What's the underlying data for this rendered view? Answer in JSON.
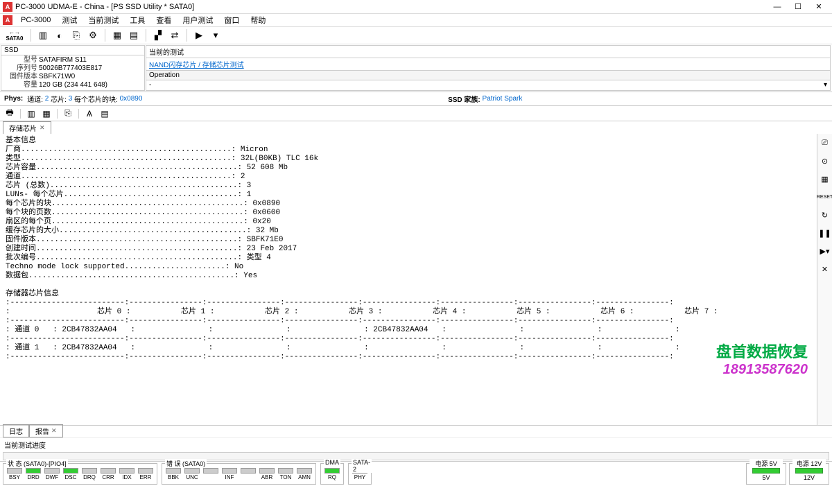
{
  "title": "PC-3000 UDMA-E - China - [PS SSD Utility * SATA0]",
  "menu": {
    "app": "PC-3000",
    "items": [
      "测试",
      "当前测试",
      "工具",
      "查看",
      "用户测试",
      "窗口",
      "帮助"
    ]
  },
  "toolbar_sata": "SATA0",
  "ssd": {
    "header": "SSD",
    "model_k": "型号",
    "model_v": "SATAFIRM   S11",
    "serial_k": "序列号",
    "serial_v": "50026B777403E817",
    "fw_k": "固件版本",
    "fw_v": "SBFK71W0",
    "cap_k": "容量",
    "cap_v": "120 GB (234 441 648)"
  },
  "testpanel": {
    "head": "当前的测试",
    "link": "NAND闪存芯片 / 存储芯片测试",
    "op": "Operation",
    "minus": "-"
  },
  "phys": {
    "label": "Phys:",
    "chan_k": "通道:",
    "chan_v": "2",
    "chip_k": "芯片:",
    "chip_v": "3",
    "blk_k": "每个芯片的块:",
    "blk_v": "0x0890",
    "fam_k": "SSD 家族:",
    "fam_v": "Patriot Spark"
  },
  "tab": "存储芯片",
  "watermark": {
    "l1": "盘首数据恢复",
    "l2": "18913587620"
  },
  "basic_title": "基本信息",
  "basic_rows": [
    [
      "厂商.",
      "Micron"
    ],
    [
      "类型.",
      "32L(B0KB) TLC 16k"
    ],
    [
      "芯片容量.",
      "52 608 Mb"
    ],
    [
      "通道.",
      "2"
    ],
    [
      "芯片 (总数).",
      "3"
    ],
    [
      "LUNs- 每个芯片.",
      "1"
    ],
    [
      "每个芯片的块.",
      "0x0890"
    ],
    [
      "每个块的页数.",
      "0x0600"
    ],
    [
      "扇区的每个页.",
      "0x20"
    ],
    [
      "缓存芯片的大小.",
      "32 Mb"
    ],
    [
      "固件版本.",
      "SBFK71E0"
    ],
    [
      "创建时间.",
      "23 Feb 2017"
    ],
    [
      "批次编号.",
      "类型 4"
    ],
    [
      "Techno mode lock supported.",
      "No"
    ],
    [
      "数据包.",
      "Yes"
    ]
  ],
  "storage_title": "存储器芯片信息",
  "chip_cols": [
    "芯片 0",
    "芯片 1",
    "芯片 2",
    "芯片 3",
    "芯片 4",
    "芯片 5",
    "芯片 6",
    "芯片 7"
  ],
  "chip_rows": [
    {
      "ch": "通道 0",
      "vals": [
        "2CB47832AA04",
        "",
        "",
        "",
        "2CB47832AA04",
        "",
        "",
        ""
      ]
    },
    {
      "ch": "通道 1",
      "vals": [
        "2CB47832AA04",
        "",
        "",
        "",
        "",
        "",
        "",
        ""
      ]
    }
  ],
  "bottomtabs": [
    "日志",
    "报告"
  ],
  "progress_label": "当前测试进度",
  "status": {
    "g1": {
      "label": "状 态 (SATA0)-[PIO4]",
      "items": [
        "BSY",
        "DRD",
        "DWF",
        "DSC",
        "DRQ",
        "CRR",
        "IDX",
        "ERR"
      ]
    },
    "g2": {
      "label": "错 误 (SATA0)",
      "items": [
        "BBK",
        "UNC",
        "",
        "INF",
        "",
        "ABR",
        "TON",
        "AMN"
      ]
    },
    "g3": {
      "label": "DMA",
      "items": [
        "RQ"
      ]
    },
    "g4": {
      "label": "SATA-2",
      "items": [
        "PHY"
      ]
    },
    "pwr": [
      {
        "label": "电源 5V",
        "v": "5V"
      },
      {
        "label": "电源 12V",
        "v": "12V"
      }
    ]
  }
}
